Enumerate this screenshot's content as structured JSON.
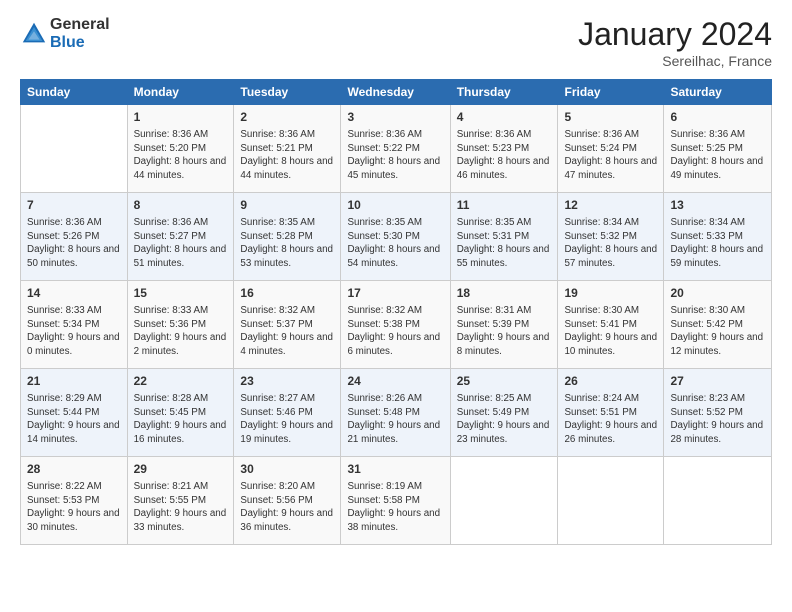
{
  "header": {
    "logo_general": "General",
    "logo_blue": "Blue",
    "month_title": "January 2024",
    "subtitle": "Sereilhac, France"
  },
  "weekdays": [
    "Sunday",
    "Monday",
    "Tuesday",
    "Wednesday",
    "Thursday",
    "Friday",
    "Saturday"
  ],
  "weeks": [
    [
      {
        "day": "",
        "sunrise": "",
        "sunset": "",
        "daylight": ""
      },
      {
        "day": "1",
        "sunrise": "Sunrise: 8:36 AM",
        "sunset": "Sunset: 5:20 PM",
        "daylight": "Daylight: 8 hours and 44 minutes."
      },
      {
        "day": "2",
        "sunrise": "Sunrise: 8:36 AM",
        "sunset": "Sunset: 5:21 PM",
        "daylight": "Daylight: 8 hours and 44 minutes."
      },
      {
        "day": "3",
        "sunrise": "Sunrise: 8:36 AM",
        "sunset": "Sunset: 5:22 PM",
        "daylight": "Daylight: 8 hours and 45 minutes."
      },
      {
        "day": "4",
        "sunrise": "Sunrise: 8:36 AM",
        "sunset": "Sunset: 5:23 PM",
        "daylight": "Daylight: 8 hours and 46 minutes."
      },
      {
        "day": "5",
        "sunrise": "Sunrise: 8:36 AM",
        "sunset": "Sunset: 5:24 PM",
        "daylight": "Daylight: 8 hours and 47 minutes."
      },
      {
        "day": "6",
        "sunrise": "Sunrise: 8:36 AM",
        "sunset": "Sunset: 5:25 PM",
        "daylight": "Daylight: 8 hours and 49 minutes."
      }
    ],
    [
      {
        "day": "7",
        "sunrise": "Sunrise: 8:36 AM",
        "sunset": "Sunset: 5:26 PM",
        "daylight": "Daylight: 8 hours and 50 minutes."
      },
      {
        "day": "8",
        "sunrise": "Sunrise: 8:36 AM",
        "sunset": "Sunset: 5:27 PM",
        "daylight": "Daylight: 8 hours and 51 minutes."
      },
      {
        "day": "9",
        "sunrise": "Sunrise: 8:35 AM",
        "sunset": "Sunset: 5:28 PM",
        "daylight": "Daylight: 8 hours and 53 minutes."
      },
      {
        "day": "10",
        "sunrise": "Sunrise: 8:35 AM",
        "sunset": "Sunset: 5:30 PM",
        "daylight": "Daylight: 8 hours and 54 minutes."
      },
      {
        "day": "11",
        "sunrise": "Sunrise: 8:35 AM",
        "sunset": "Sunset: 5:31 PM",
        "daylight": "Daylight: 8 hours and 55 minutes."
      },
      {
        "day": "12",
        "sunrise": "Sunrise: 8:34 AM",
        "sunset": "Sunset: 5:32 PM",
        "daylight": "Daylight: 8 hours and 57 minutes."
      },
      {
        "day": "13",
        "sunrise": "Sunrise: 8:34 AM",
        "sunset": "Sunset: 5:33 PM",
        "daylight": "Daylight: 8 hours and 59 minutes."
      }
    ],
    [
      {
        "day": "14",
        "sunrise": "Sunrise: 8:33 AM",
        "sunset": "Sunset: 5:34 PM",
        "daylight": "Daylight: 9 hours and 0 minutes."
      },
      {
        "day": "15",
        "sunrise": "Sunrise: 8:33 AM",
        "sunset": "Sunset: 5:36 PM",
        "daylight": "Daylight: 9 hours and 2 minutes."
      },
      {
        "day": "16",
        "sunrise": "Sunrise: 8:32 AM",
        "sunset": "Sunset: 5:37 PM",
        "daylight": "Daylight: 9 hours and 4 minutes."
      },
      {
        "day": "17",
        "sunrise": "Sunrise: 8:32 AM",
        "sunset": "Sunset: 5:38 PM",
        "daylight": "Daylight: 9 hours and 6 minutes."
      },
      {
        "day": "18",
        "sunrise": "Sunrise: 8:31 AM",
        "sunset": "Sunset: 5:39 PM",
        "daylight": "Daylight: 9 hours and 8 minutes."
      },
      {
        "day": "19",
        "sunrise": "Sunrise: 8:30 AM",
        "sunset": "Sunset: 5:41 PM",
        "daylight": "Daylight: 9 hours and 10 minutes."
      },
      {
        "day": "20",
        "sunrise": "Sunrise: 8:30 AM",
        "sunset": "Sunset: 5:42 PM",
        "daylight": "Daylight: 9 hours and 12 minutes."
      }
    ],
    [
      {
        "day": "21",
        "sunrise": "Sunrise: 8:29 AM",
        "sunset": "Sunset: 5:44 PM",
        "daylight": "Daylight: 9 hours and 14 minutes."
      },
      {
        "day": "22",
        "sunrise": "Sunrise: 8:28 AM",
        "sunset": "Sunset: 5:45 PM",
        "daylight": "Daylight: 9 hours and 16 minutes."
      },
      {
        "day": "23",
        "sunrise": "Sunrise: 8:27 AM",
        "sunset": "Sunset: 5:46 PM",
        "daylight": "Daylight: 9 hours and 19 minutes."
      },
      {
        "day": "24",
        "sunrise": "Sunrise: 8:26 AM",
        "sunset": "Sunset: 5:48 PM",
        "daylight": "Daylight: 9 hours and 21 minutes."
      },
      {
        "day": "25",
        "sunrise": "Sunrise: 8:25 AM",
        "sunset": "Sunset: 5:49 PM",
        "daylight": "Daylight: 9 hours and 23 minutes."
      },
      {
        "day": "26",
        "sunrise": "Sunrise: 8:24 AM",
        "sunset": "Sunset: 5:51 PM",
        "daylight": "Daylight: 9 hours and 26 minutes."
      },
      {
        "day": "27",
        "sunrise": "Sunrise: 8:23 AM",
        "sunset": "Sunset: 5:52 PM",
        "daylight": "Daylight: 9 hours and 28 minutes."
      }
    ],
    [
      {
        "day": "28",
        "sunrise": "Sunrise: 8:22 AM",
        "sunset": "Sunset: 5:53 PM",
        "daylight": "Daylight: 9 hours and 30 minutes."
      },
      {
        "day": "29",
        "sunrise": "Sunrise: 8:21 AM",
        "sunset": "Sunset: 5:55 PM",
        "daylight": "Daylight: 9 hours and 33 minutes."
      },
      {
        "day": "30",
        "sunrise": "Sunrise: 8:20 AM",
        "sunset": "Sunset: 5:56 PM",
        "daylight": "Daylight: 9 hours and 36 minutes."
      },
      {
        "day": "31",
        "sunrise": "Sunrise: 8:19 AM",
        "sunset": "Sunset: 5:58 PM",
        "daylight": "Daylight: 9 hours and 38 minutes."
      },
      {
        "day": "",
        "sunrise": "",
        "sunset": "",
        "daylight": ""
      },
      {
        "day": "",
        "sunrise": "",
        "sunset": "",
        "daylight": ""
      },
      {
        "day": "",
        "sunrise": "",
        "sunset": "",
        "daylight": ""
      }
    ]
  ]
}
